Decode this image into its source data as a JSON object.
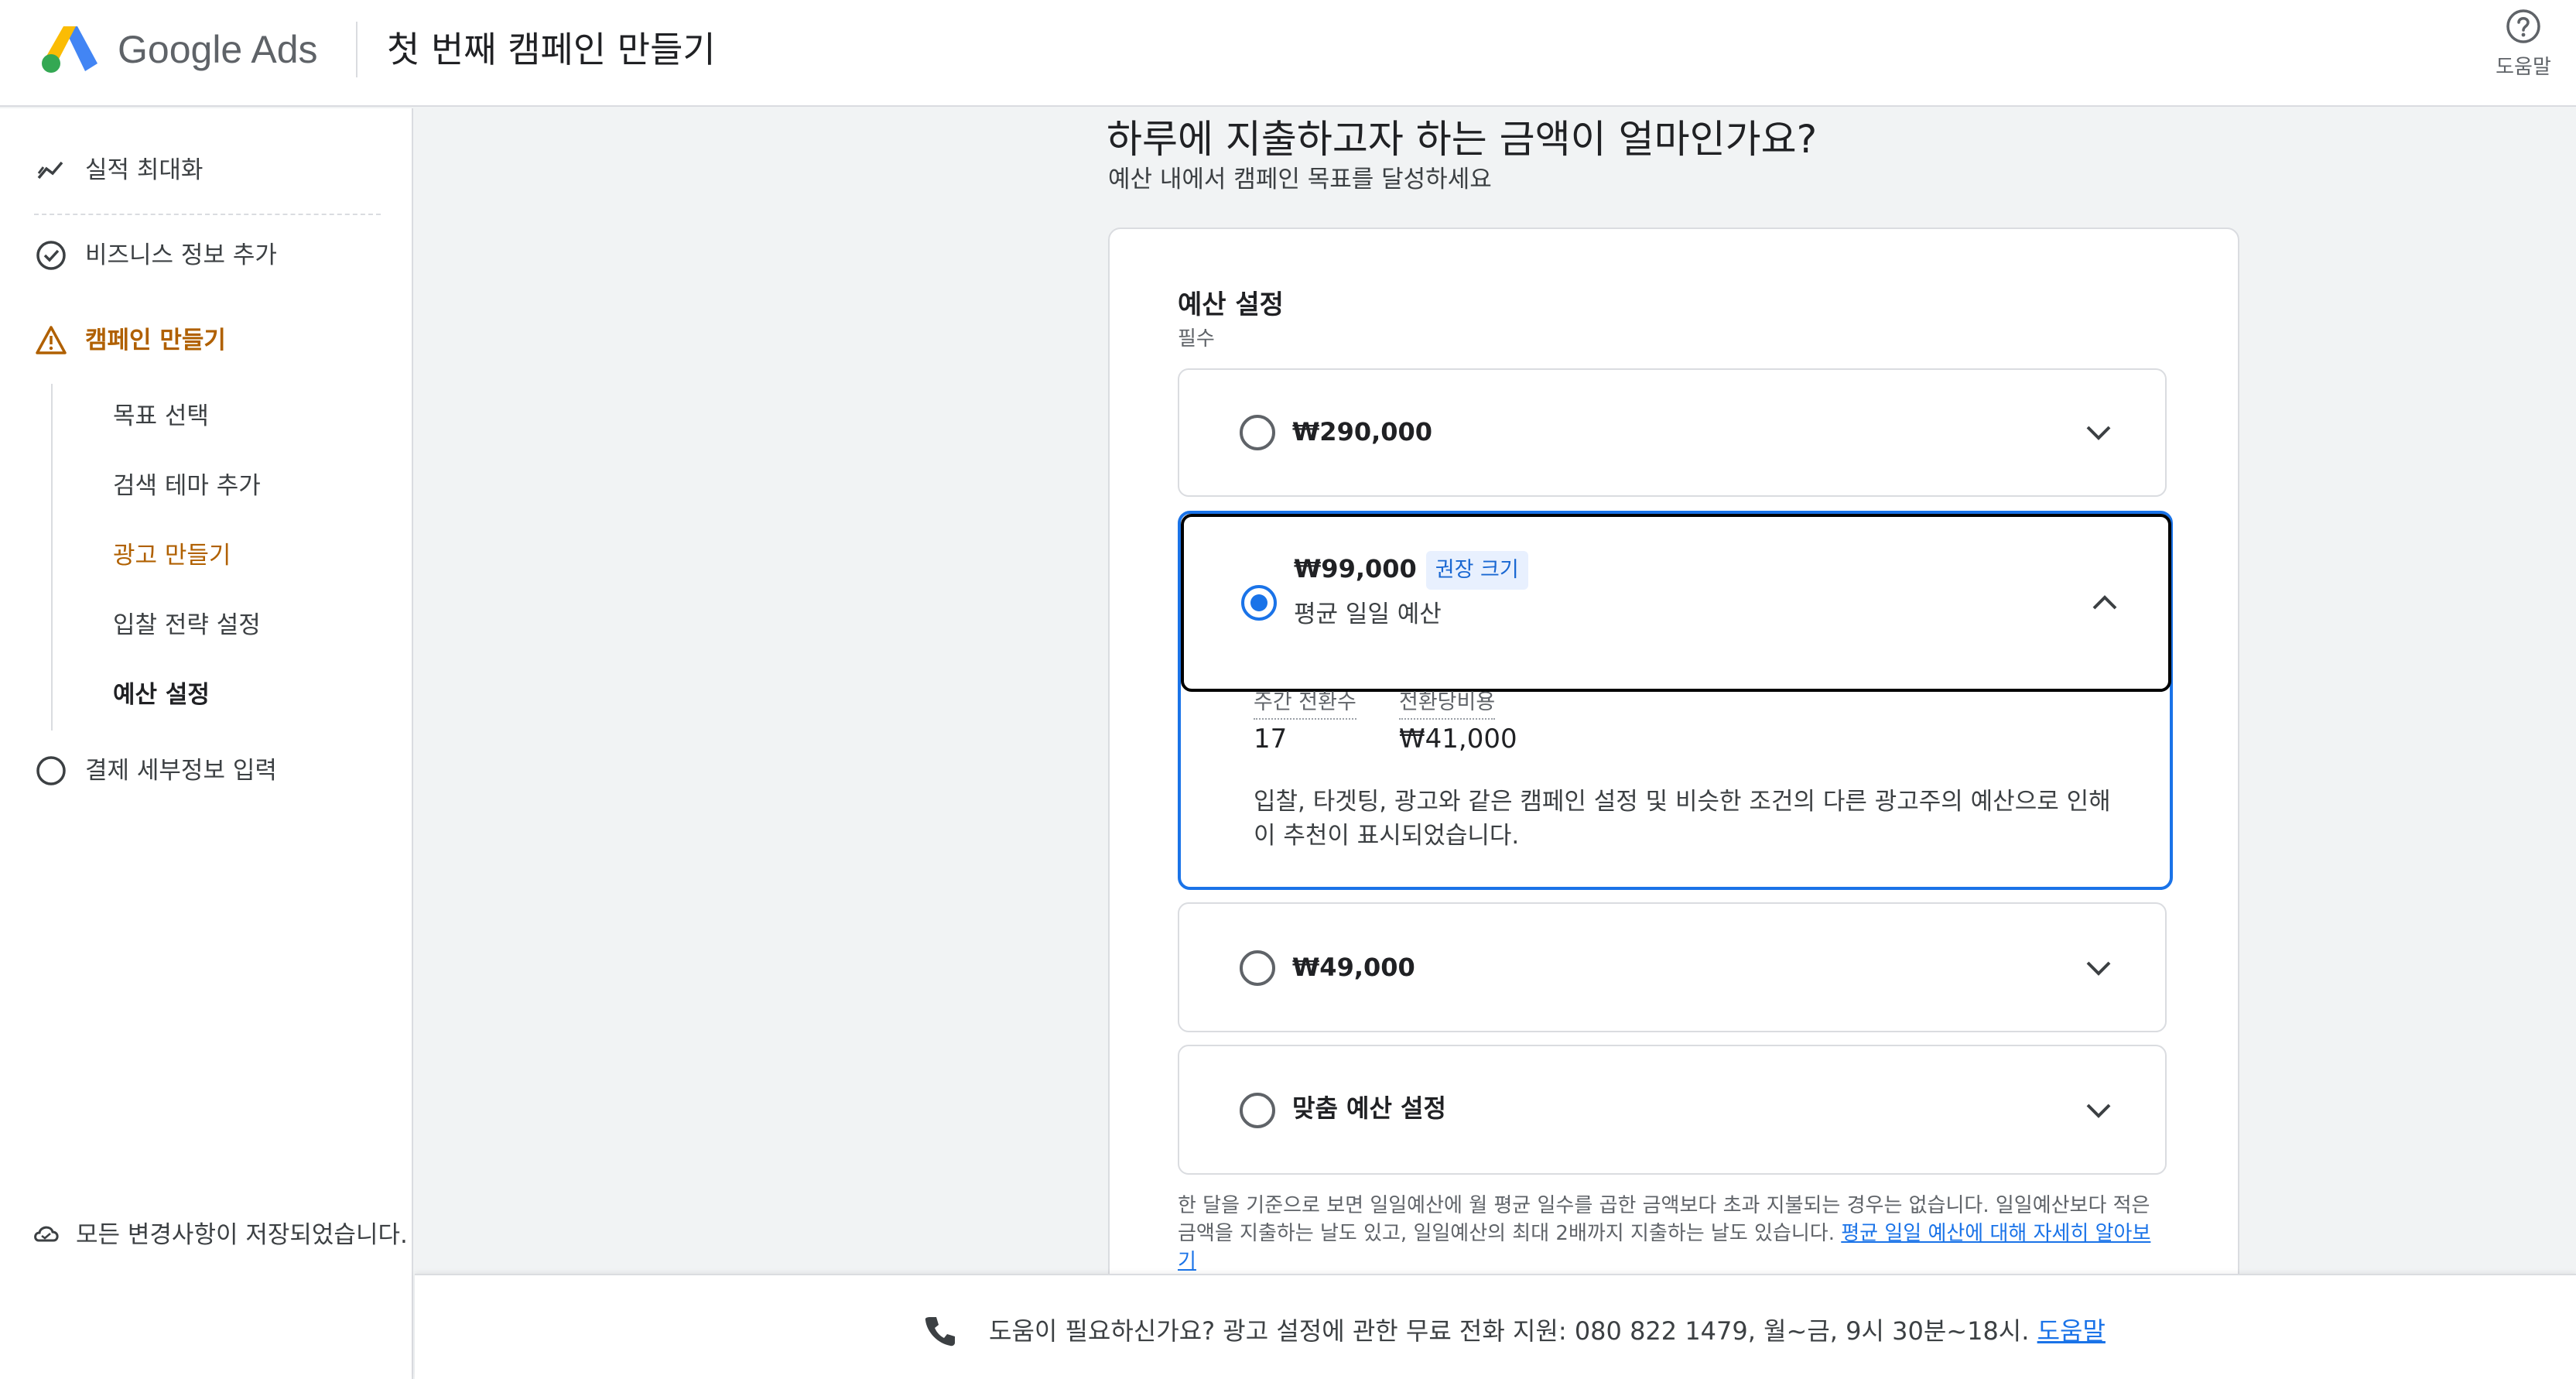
{
  "header": {
    "brand": "Google Ads",
    "title": "첫 번째 캠페인 만들기",
    "help_label": "도움말"
  },
  "sidebar": {
    "items": [
      {
        "label": "실적 최대화",
        "icon": "trending-icon"
      },
      {
        "label": "비즈니스 정보 추가",
        "icon": "check-circle-icon"
      },
      {
        "label": "캠페인 만들기",
        "icon": "warning-icon"
      },
      {
        "label": "결제 세부정보 입력",
        "icon": "circle-icon"
      }
    ],
    "sub_items": [
      "목표 선택",
      "검색 테마 추가",
      "광고 만들기",
      "입찰 전략 설정",
      "예산 설정"
    ],
    "saved_status": "모든 변경사항이 저장되었습니다."
  },
  "main": {
    "title": "하루에 지출하고자 하는 금액이 얼마인가요?",
    "subtitle": "예산 내에서 캠페인 목표를 달성하세요",
    "section_title": "예산 설정",
    "required": "필수",
    "options": [
      {
        "label": "₩290,000",
        "selected": false
      },
      {
        "label": "₩99,000",
        "badge": "권장 크기",
        "subtext": "평균 일일 예산",
        "selected": true
      },
      {
        "label": "₩49,000",
        "selected": false
      },
      {
        "label": "맞춤 예산 설정",
        "selected": false
      }
    ],
    "metrics": [
      {
        "label": "주간 전환수",
        "value": "17"
      },
      {
        "label": "전환당비용",
        "value": "₩41,000"
      }
    ],
    "explanation": "입찰, 타겟팅, 광고와 같은 캠페인 설정 및 비슷한 조건의 다른 광고주의 예산으로 인해 이 추천이 표시되었습니다.",
    "footnote": "한 달을 기준으로 보면 일일예산에 월 평균 일수를 곱한 금액보다 초과 지불되는 경우는 없습니다. 일일예산보다 적은 금액을 지출하는 날도 있고, 일일예산의 최대 2배까지 지출하는 날도 있습니다.",
    "footnote_link": "평균 일일 예산에 대해 자세히 알아보기"
  },
  "bottom_bar": {
    "text": "도움이 필요하신가요? 광고 설정에 관한 무료 전화 지원: 080 822 1479, 월~금, 9시 30분~18시.",
    "link": "도움말"
  },
  "colors": {
    "accent": "#1a73e8",
    "warning": "#b06000",
    "text": "#202124",
    "muted": "#5f6368"
  }
}
